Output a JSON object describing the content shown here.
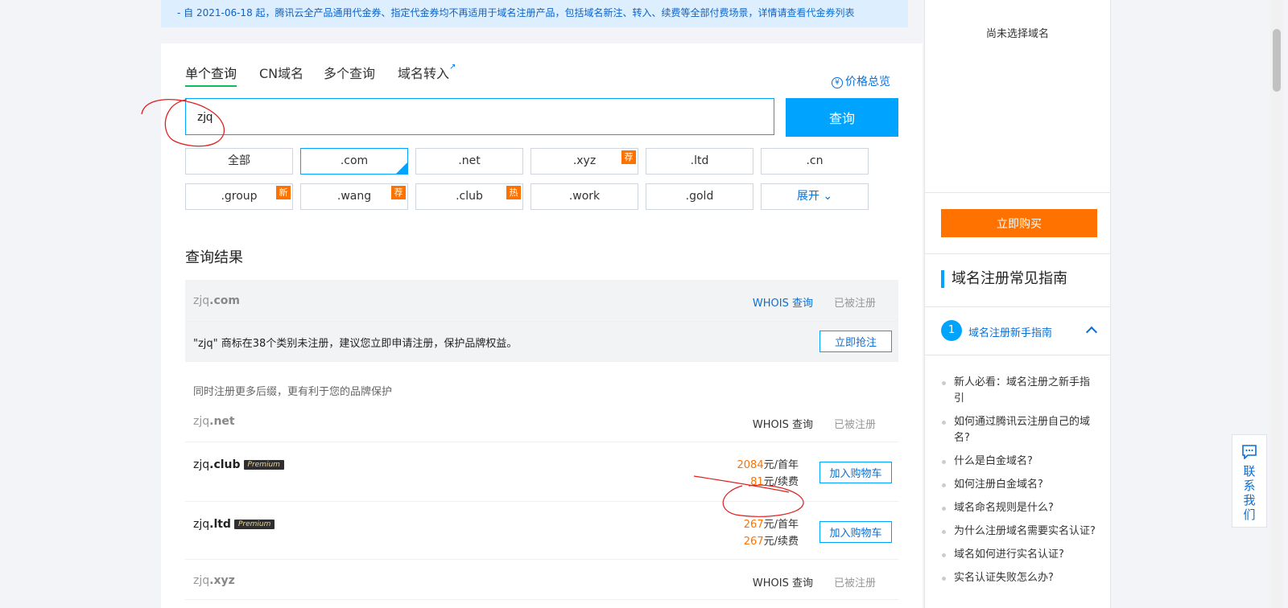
{
  "notice": {
    "text": "- 自 2021-06-18 起，腾讯云全产品通用代金券、指定代金券均不再适用于域名注册产品，包括域名新注、转入、续费等全部付费场景，详情请",
    "link": "查看代金券列表"
  },
  "tabs": [
    {
      "label": "单个查询",
      "active": true
    },
    {
      "label": "CN域名"
    },
    {
      "label": "多个查询"
    },
    {
      "label": "域名转入",
      "external": true
    }
  ],
  "price_overview": "价格总览",
  "search": {
    "value": "zjq",
    "button": "查询"
  },
  "suffixes": [
    {
      "label": "全部"
    },
    {
      "label": ".com",
      "selected": true
    },
    {
      "label": ".net"
    },
    {
      "label": ".xyz",
      "tag": "荐"
    },
    {
      "label": ".ltd"
    },
    {
      "label": ".cn"
    },
    {
      "label": ".group",
      "tag": "新"
    },
    {
      "label": ".wang",
      "tag": "荐"
    },
    {
      "label": ".club",
      "tag": "热"
    },
    {
      "label": ".work"
    },
    {
      "label": ".gold"
    },
    {
      "label": "展开"
    }
  ],
  "results": {
    "title": "查询结果",
    "whois": "WHOIS 查询",
    "registered": "已被注册",
    "add_cart": "加入购物车",
    "premium": "Premium",
    "rows": {
      "com": {
        "name": "zjq",
        "suffix": ".com"
      },
      "net": {
        "name": "zjq",
        "suffix": ".net"
      },
      "club": {
        "name": "zjq",
        "suffix": ".club",
        "first_year": "2084",
        "first_year_unit": "元/首年",
        "renewal": "81",
        "renewal_unit": "元/续费"
      },
      "ltd": {
        "name": "zjq",
        "suffix": ".ltd",
        "first_year": "267",
        "first_year_unit": "元/首年",
        "renewal": "267",
        "renewal_unit": "元/续费"
      },
      "xyz": {
        "name": "zjq",
        "suffix": ".xyz"
      }
    },
    "trademark_text": "\"zjq\" 商标在38个类别未注册，建议您立即申请注册，保护品牌权益。",
    "trademark_button": "立即抢注",
    "more_hint": "同时注册更多后缀，更有利于您的品牌保护"
  },
  "side": {
    "no_selection": "尚未选择域名",
    "buy_button": "立即购买",
    "guide_title": "域名注册常见指南",
    "guide_section_number": "1",
    "guide_section_title": "域名注册新手指南",
    "faq": [
      "新人必看：域名注册之新手指引",
      "如何通过腾讯云注册自己的域名?",
      "什么是白金域名?",
      "如何注册白金域名?",
      "域名命名规则是什么?",
      "为什么注册域名需要实名认证?",
      "域名如何进行实名认证?",
      "实名认证失败怎么办?"
    ]
  },
  "contact": "联系我们",
  "colors": {
    "accent": "#00a4ff",
    "orange": "#ff7200",
    "link": "#0a6fd6",
    "annotation": "#e02020"
  }
}
